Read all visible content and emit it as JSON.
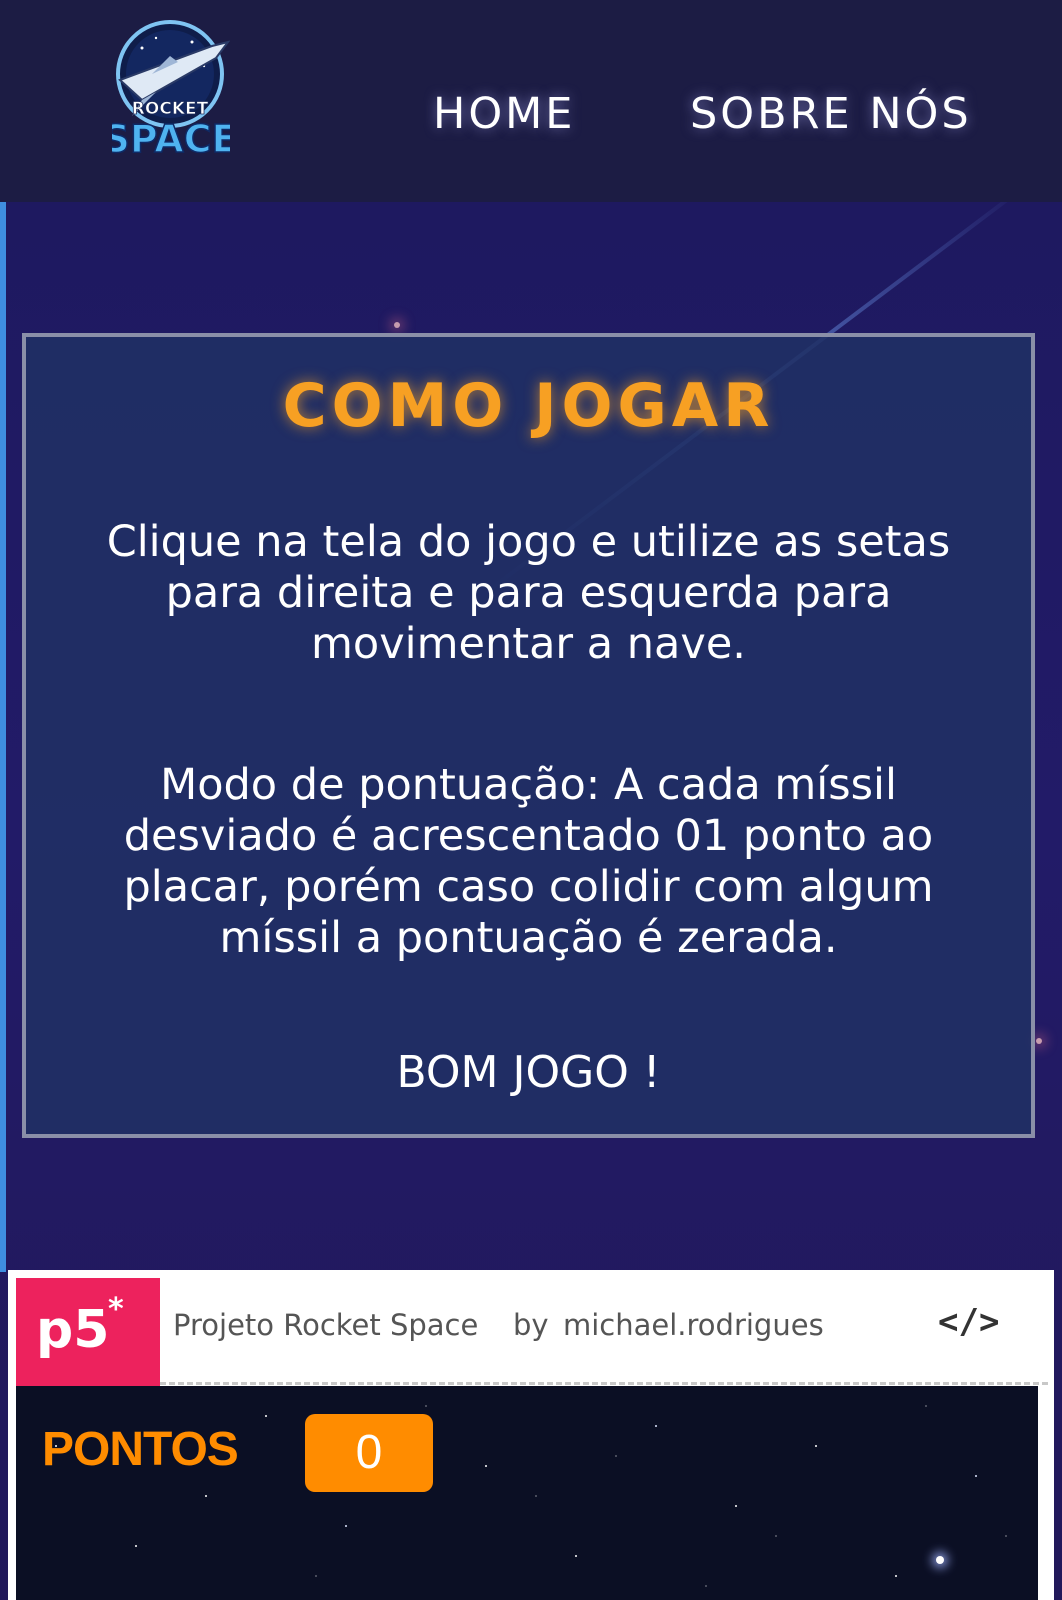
{
  "header": {
    "logo_alt": "ROCKET SPACE",
    "logo_line1": "ROCKET",
    "logo_line2": "SPACE",
    "nav": [
      {
        "label": "HOME"
      },
      {
        "label": "SOBRE NÓS"
      }
    ]
  },
  "howto": {
    "title": "COMO JOGAR",
    "instructions": "Clique na tela do jogo e utilize as setas para direita e para esquerda para movimentar a nave.",
    "scoring": "Modo de pontuação: A cada míssil desviado é acrescentado 01 ponto ao placar, porém caso colidir com algum míssil a pontuação é zerada.",
    "closing": "BOM JOGO !"
  },
  "embed": {
    "badge": "p5",
    "badge_star": "*",
    "project_title": "Projeto Rocket Space",
    "by": "by",
    "author": "michael.rodrigues",
    "code_icon": "</>",
    "game": {
      "score_label": "PONTOS",
      "score_value": "0"
    }
  },
  "colors": {
    "accent_orange": "#f7a023",
    "p5_pink": "#ed225d",
    "score_orange": "#ff8c00",
    "header_bg": "#1c1c44"
  }
}
